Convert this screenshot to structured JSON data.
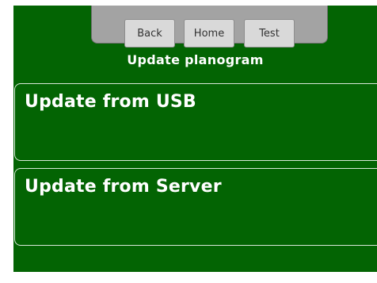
{
  "nav": {
    "back_label": "Back",
    "home_label": "Home",
    "test_label": "Test"
  },
  "page": {
    "title": "Update planogram"
  },
  "options": [
    {
      "label": "Update from USB"
    },
    {
      "label": "Update from Server"
    }
  ],
  "colors": {
    "background": "#036403",
    "tray": "#a3a3a3",
    "button": "#d9d9d9",
    "text": "#ffffff"
  }
}
